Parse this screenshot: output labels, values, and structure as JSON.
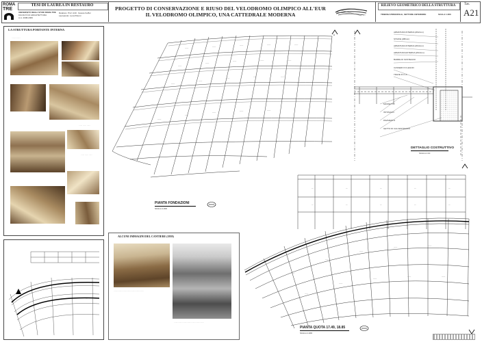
{
  "logo": {
    "line1": "ROMA",
    "line2": "TRE"
  },
  "header": {
    "thesis_title": "TESI DI LAUREA IN RESTAURO",
    "university": [
      "UNIVERSITÀ DEGLI STUDI ROMA TRE",
      "FACOLTÀ DI ARCHITETTURA",
      "A.A. 2008-2009"
    ],
    "relatore": "Relatore: Prof. Arch. Cesare Feiffer",
    "laureando": "Laureando: Luca Pistoni",
    "project_title": "PROGETTO DI CONSERVAZIONE E RIUSO DEL VELODROMO OLIMPICO ALL'EUR",
    "project_subtitle": "IL VELODROMO OLIMPICO, UNA CATTEDRALE MODERNA",
    "survey_title": "RILIEVO GEOMETRICO DELLA STRUTTURA",
    "survey_sub1": "TRIBUNA PRINCIPALE, SETTORE ANTERIORE",
    "survey_sub2": "SCALA 1:200",
    "tav_label": "Tav.",
    "tav_number": "A21"
  },
  "left_panel": {
    "section_title": "LA STRUTTURA PORTANTE INTERNA"
  },
  "construction_panel": {
    "title": "ALCUNE IMMAGINI DEL CANTIERE (1959)"
  },
  "detail_labels": [
    "ARMATURA INTERNA (Ø12mm)",
    "STAFFE (Ø8mm)",
    "ARMATURA INTERNA (Ø14mm)",
    "ARMATURA ESTERNA (Ø14mm)",
    "BARRE DI SOSTEGNO",
    "CASSERO IN LEGNO",
    "TRAVE IN C.A.",
    "MASSETTO",
    "INTONACO",
    "PAVIMENTO",
    "GETTO DI CALCESTRUZZO"
  ],
  "plans": {
    "foundations_title": "PIANTA FONDAZIONI",
    "foundations_scale": "SCALA 1:200",
    "level_title": "PIANTA QUOTA 17.49, 18.85",
    "level_scale": "SCALA 1:200",
    "detail_title": "DETTAGLIO COSTRUTTIVO",
    "detail_scale": "SCALA 1:10"
  }
}
